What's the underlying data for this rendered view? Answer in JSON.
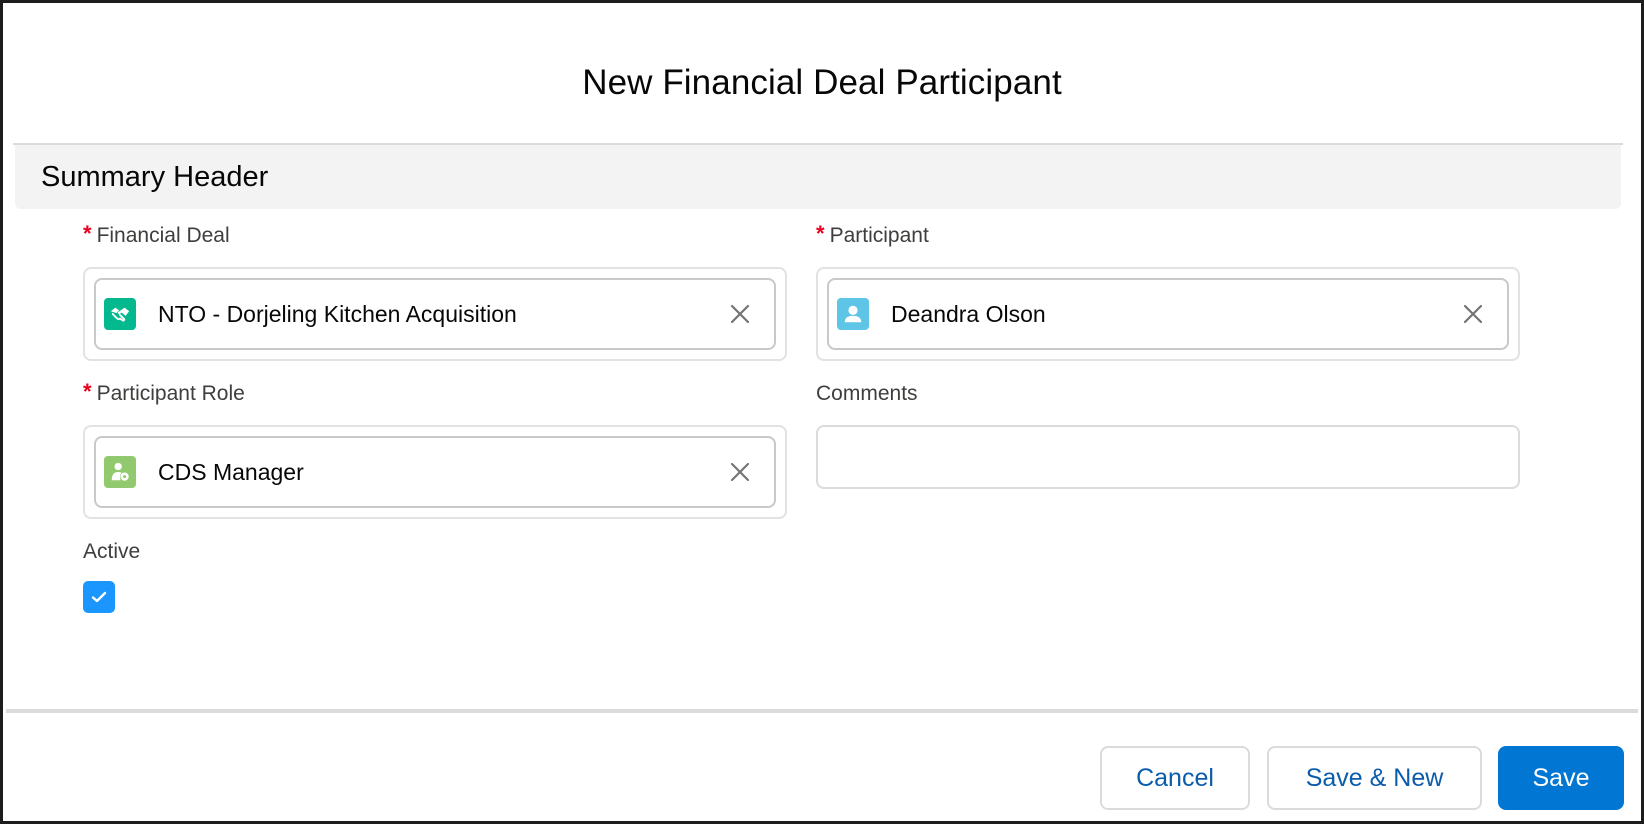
{
  "modal": {
    "title": "New Financial Deal Participant"
  },
  "section": {
    "title": "Summary Header"
  },
  "fields": {
    "financial_deal": {
      "label": "Financial Deal",
      "required_marker": "*",
      "value": "NTO - Dorjeling Kitchen Acquisition",
      "icon": "handshake-icon",
      "icon_color": "#04b98d",
      "clear_icon": "close-icon"
    },
    "participant": {
      "label": "Participant",
      "required_marker": "*",
      "value": "Deandra Olson",
      "icon": "user-icon",
      "icon_color": "#5ec5e6",
      "clear_icon": "close-icon"
    },
    "participant_role": {
      "label": "Participant Role",
      "required_marker": "*",
      "value": "CDS Manager",
      "icon": "user-role-icon",
      "icon_color": "#90c96e",
      "clear_icon": "close-icon"
    },
    "comments": {
      "label": "Comments",
      "value": "",
      "placeholder": ""
    },
    "active": {
      "label": "Active",
      "checked": true
    }
  },
  "footer": {
    "cancel_label": "Cancel",
    "save_new_label": "Save & New",
    "save_label": "Save"
  },
  "colors": {
    "brand": "#0176d3",
    "required": "#ea001e",
    "checkbox": "#1b96ff",
    "section_bg": "#f3f3f3"
  }
}
